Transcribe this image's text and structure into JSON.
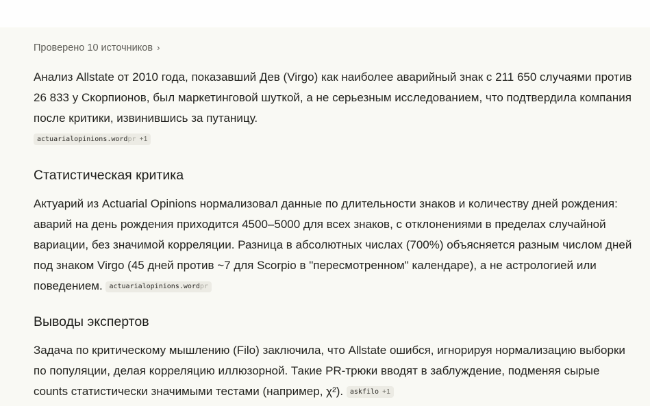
{
  "sources": {
    "label": "Проверено 10 источников",
    "chevron": "›"
  },
  "p1": {
    "text": "Анализ Allstate от 2010 года, показавший Дев (Virgo) как наиболее аварийный знак с 211 650 случаями против 26 833 у Скорпионов, был маркетинговой шуткой, а не серьезным исследованием, что подтвердила компания после критики, извинившись за путаницу.",
    "chip": {
      "main": "actuarialopinions.word",
      "fade": "pr",
      "more": "+1"
    }
  },
  "h1": "Статистическая критика",
  "p2": {
    "text": "Актуарий из Actuarial Opinions нормализовал данные по длительности знаков и количеству дней рождения: аварий на день рождения приходится 4500–5000 для всех знаков, с отклонениями в пределах случайной вариации, без значимой корреляции. Разница в абсолютных числах (700%) объясняется разным числом дней под знаком Virgo (45 дней против ~7 для Scorpio в \"пересмотренном\" календаре), а не астрологией или поведением.",
    "chip": {
      "main": "actuarialopinions.word",
      "fade": "pr"
    }
  },
  "h2": "Выводы экспертов",
  "p3": {
    "text": "Задача по критическому мышлению (Filo) заключила, что Allstate ошибся, игнорируя нормализацию выборки по популяции, делая корреляцию иллюзорной. Такие PR-трюки вводят в заблуждение, подменяя сырые counts статистически значимыми тестами (например, χ²).",
    "chip": {
      "main": "askfilo",
      "more": "+1"
    }
  }
}
